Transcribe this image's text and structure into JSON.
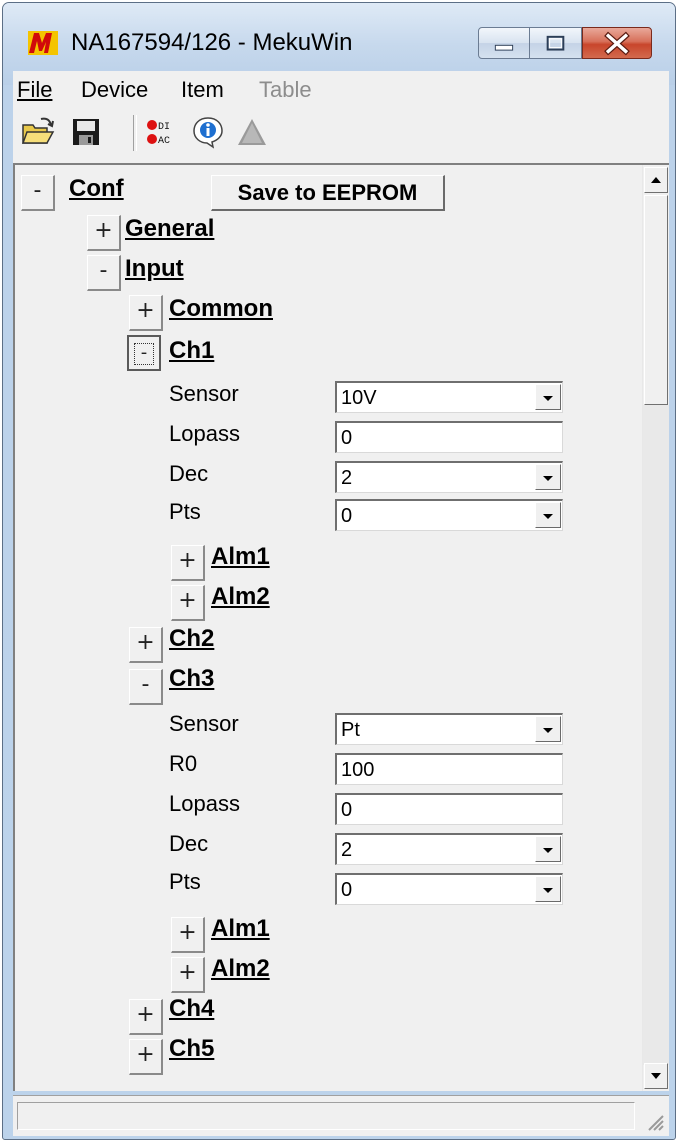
{
  "window": {
    "title": "NA167594/126 - MekuWin"
  },
  "menubar": {
    "items": [
      "File",
      "Device",
      "Item",
      "Table"
    ]
  },
  "toolbar": {
    "icons": [
      "open-folder-icon",
      "save-disk-icon",
      "di-ac-icon",
      "info-icon",
      "triangle-icon"
    ],
    "di_text": "DI",
    "ac_text": "AC"
  },
  "tree": {
    "root": {
      "label": "Conf",
      "expander": "-"
    },
    "save_button": "Save to EEPROM",
    "general": {
      "label": "General",
      "expander": "+"
    },
    "input": {
      "label": "Input",
      "expander": "-"
    },
    "common": {
      "label": "Common",
      "expander": "+"
    },
    "ch1": {
      "label": "Ch1",
      "expander": "-",
      "fields": [
        {
          "label": "Sensor",
          "value": "10V",
          "dropdown": true
        },
        {
          "label": "Lopass",
          "value": "0",
          "dropdown": false
        },
        {
          "label": "Dec",
          "value": "2",
          "dropdown": true
        },
        {
          "label": "Pts",
          "value": "0",
          "dropdown": true
        }
      ],
      "alm1": {
        "label": "Alm1",
        "expander": "+"
      },
      "alm2": {
        "label": "Alm2",
        "expander": "+"
      }
    },
    "ch2": {
      "label": "Ch2",
      "expander": "+"
    },
    "ch3": {
      "label": "Ch3",
      "expander": "-",
      "fields": [
        {
          "label": "Sensor",
          "value": "Pt",
          "dropdown": true
        },
        {
          "label": "R0",
          "value": "100",
          "dropdown": false
        },
        {
          "label": "Lopass",
          "value": "0",
          "dropdown": false
        },
        {
          "label": "Dec",
          "value": "2",
          "dropdown": true
        },
        {
          "label": "Pts",
          "value": "0",
          "dropdown": true
        }
      ],
      "alm1": {
        "label": "Alm1",
        "expander": "+"
      },
      "alm2": {
        "label": "Alm2",
        "expander": "+"
      }
    },
    "ch4": {
      "label": "Ch4",
      "expander": "+"
    },
    "ch5": {
      "label": "Ch5",
      "expander": "+"
    }
  },
  "colors": {
    "titlebar": "#c7d9ed",
    "close_button": "#c8452b",
    "panel": "#f0f0f0"
  }
}
